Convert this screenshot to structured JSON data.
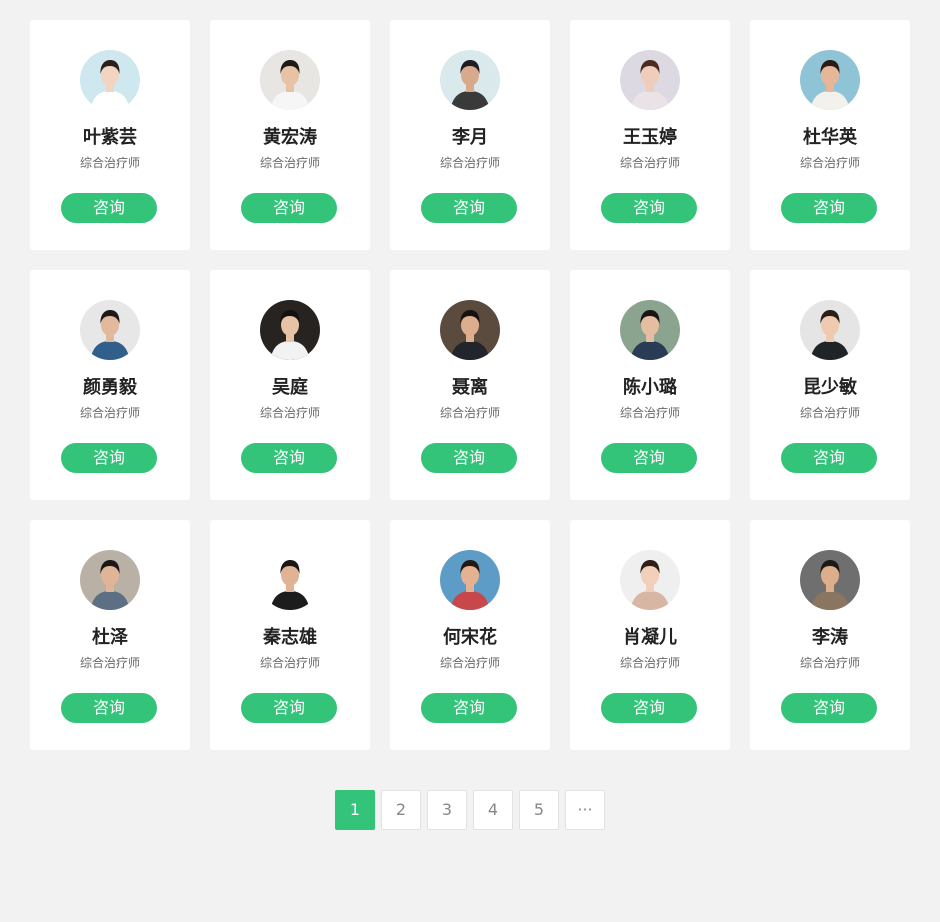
{
  "colors": {
    "accent": "#33c47a",
    "page_bg": "#f2f2f2",
    "card_bg": "#ffffff",
    "name_text": "#222222",
    "title_text": "#666666"
  },
  "doctors": [
    {
      "name": "叶紫芸",
      "title": "综合治疗师",
      "button": "咨询",
      "avatar": {
        "bg": "#cfe7ef",
        "skin": "#f2d4c0",
        "hair": "#2a211d",
        "shirt": "#ffffff"
      }
    },
    {
      "name": "黄宏涛",
      "title": "综合治疗师",
      "button": "咨询",
      "avatar": {
        "bg": "#e8e6e3",
        "skin": "#e8c2a4",
        "hair": "#1f1a17",
        "shirt": "#f6f6f6"
      }
    },
    {
      "name": "李月",
      "title": "综合治疗师",
      "button": "咨询",
      "avatar": {
        "bg": "#d9e9ec",
        "skin": "#d9a98c",
        "hair": "#1d1d24",
        "shirt": "#3a3a3a"
      }
    },
    {
      "name": "王玉婷",
      "title": "综合治疗师",
      "button": "咨询",
      "avatar": {
        "bg": "#ddd9e3",
        "skin": "#efcdbb",
        "hair": "#4a2c22",
        "shirt": "#e9e2e7"
      }
    },
    {
      "name": "杜华英",
      "title": "综合治疗师",
      "button": "咨询",
      "avatar": {
        "bg": "#8fc4d6",
        "skin": "#e6b699",
        "hair": "#2b1d16",
        "shirt": "#f3f1ee"
      }
    },
    {
      "name": "颜勇毅",
      "title": "综合治疗师",
      "button": "咨询",
      "avatar": {
        "bg": "#e7e7e7",
        "skin": "#e2b99d",
        "hair": "#1c1a19",
        "shirt": "#2f5f8a"
      }
    },
    {
      "name": "吴庭",
      "title": "综合治疗师",
      "button": "咨询",
      "avatar": {
        "bg": "#262321",
        "skin": "#e6c2a6",
        "hair": "#141210",
        "shirt": "#f2f2f2"
      }
    },
    {
      "name": "聂离",
      "title": "综合治疗师",
      "button": "咨询",
      "avatar": {
        "bg": "#5b4a3e",
        "skin": "#dcae8e",
        "hair": "#15120f",
        "shirt": "#22252c"
      }
    },
    {
      "name": "陈小璐",
      "title": "综合治疗师",
      "button": "咨询",
      "avatar": {
        "bg": "#8aa48f",
        "skin": "#e5bda0",
        "hair": "#1a1513",
        "shirt": "#2a3b55"
      }
    },
    {
      "name": "昆少敏",
      "title": "综合治疗师",
      "button": "咨询",
      "avatar": {
        "bg": "#e5e5e5",
        "skin": "#efcab0",
        "hair": "#2b1e18",
        "shirt": "#1f2429"
      }
    },
    {
      "name": "杜泽",
      "title": "综合治疗师",
      "button": "咨询",
      "avatar": {
        "bg": "#b9b1a6",
        "skin": "#dfb497",
        "hair": "#1b1715",
        "shirt": "#5d6f85"
      }
    },
    {
      "name": "秦志雄",
      "title": "综合治疗师",
      "button": "咨询",
      "avatar": {
        "bg": "#ffffff",
        "skin": "#e0b394",
        "hair": "#1a1715",
        "shirt": "#1c1c1c"
      }
    },
    {
      "name": "何宋花",
      "title": "综合治疗师",
      "button": "咨询",
      "avatar": {
        "bg": "#5d9cc6",
        "skin": "#e4b290",
        "hair": "#231814",
        "shirt": "#c8474a"
      }
    },
    {
      "name": "肖凝儿",
      "title": "综合治疗师",
      "button": "咨询",
      "avatar": {
        "bg": "#f0efef",
        "skin": "#f1cfb9",
        "hair": "#2e1f19",
        "shirt": "#d7b7a3"
      }
    },
    {
      "name": "李涛",
      "title": "综合治疗师",
      "button": "咨询",
      "avatar": {
        "bg": "#6f6f6f",
        "skin": "#dcae8c",
        "hair": "#1c1a18",
        "shirt": "#8a7560"
      }
    }
  ],
  "pagination": {
    "pages": [
      "1",
      "2",
      "3",
      "4",
      "5",
      "···"
    ],
    "active": "1"
  }
}
